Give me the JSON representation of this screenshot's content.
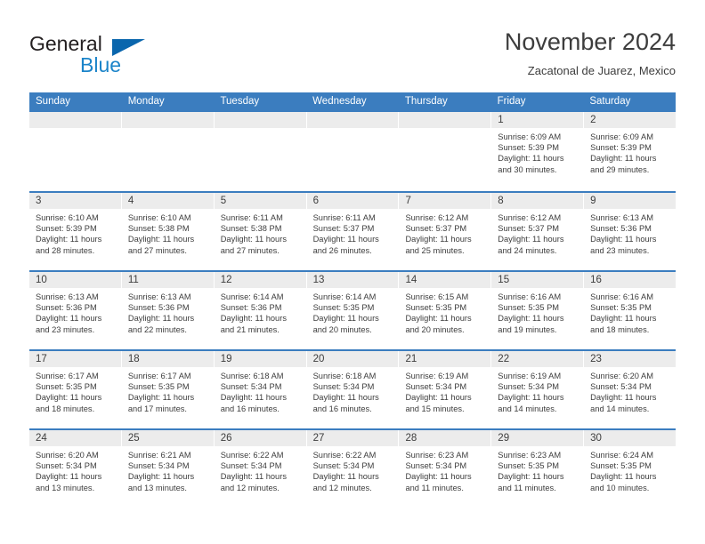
{
  "logo": {
    "word_one": "General",
    "word_two": "Blue",
    "triangle_icon": "blue-triangle-icon",
    "accent_dark": "#0a66ad",
    "accent_light": "#1b84c9"
  },
  "header": {
    "title": "November 2024",
    "subtitle": "Zacatonal de Juarez, Mexico"
  },
  "calendar": {
    "header_color": "#3b7dbf",
    "day_band_color": "#ececec",
    "weekdays": [
      "Sunday",
      "Monday",
      "Tuesday",
      "Wednesday",
      "Thursday",
      "Friday",
      "Saturday"
    ],
    "weeks": [
      [
        {
          "day": "",
          "sunrise": "",
          "sunset": "",
          "daylight": ""
        },
        {
          "day": "",
          "sunrise": "",
          "sunset": "",
          "daylight": ""
        },
        {
          "day": "",
          "sunrise": "",
          "sunset": "",
          "daylight": ""
        },
        {
          "day": "",
          "sunrise": "",
          "sunset": "",
          "daylight": ""
        },
        {
          "day": "",
          "sunrise": "",
          "sunset": "",
          "daylight": ""
        },
        {
          "day": "1",
          "sunrise": "Sunrise: 6:09 AM",
          "sunset": "Sunset: 5:39 PM",
          "daylight": "Daylight: 11 hours and 30 minutes."
        },
        {
          "day": "2",
          "sunrise": "Sunrise: 6:09 AM",
          "sunset": "Sunset: 5:39 PM",
          "daylight": "Daylight: 11 hours and 29 minutes."
        }
      ],
      [
        {
          "day": "3",
          "sunrise": "Sunrise: 6:10 AM",
          "sunset": "Sunset: 5:39 PM",
          "daylight": "Daylight: 11 hours and 28 minutes."
        },
        {
          "day": "4",
          "sunrise": "Sunrise: 6:10 AM",
          "sunset": "Sunset: 5:38 PM",
          "daylight": "Daylight: 11 hours and 27 minutes."
        },
        {
          "day": "5",
          "sunrise": "Sunrise: 6:11 AM",
          "sunset": "Sunset: 5:38 PM",
          "daylight": "Daylight: 11 hours and 27 minutes."
        },
        {
          "day": "6",
          "sunrise": "Sunrise: 6:11 AM",
          "sunset": "Sunset: 5:37 PM",
          "daylight": "Daylight: 11 hours and 26 minutes."
        },
        {
          "day": "7",
          "sunrise": "Sunrise: 6:12 AM",
          "sunset": "Sunset: 5:37 PM",
          "daylight": "Daylight: 11 hours and 25 minutes."
        },
        {
          "day": "8",
          "sunrise": "Sunrise: 6:12 AM",
          "sunset": "Sunset: 5:37 PM",
          "daylight": "Daylight: 11 hours and 24 minutes."
        },
        {
          "day": "9",
          "sunrise": "Sunrise: 6:13 AM",
          "sunset": "Sunset: 5:36 PM",
          "daylight": "Daylight: 11 hours and 23 minutes."
        }
      ],
      [
        {
          "day": "10",
          "sunrise": "Sunrise: 6:13 AM",
          "sunset": "Sunset: 5:36 PM",
          "daylight": "Daylight: 11 hours and 23 minutes."
        },
        {
          "day": "11",
          "sunrise": "Sunrise: 6:13 AM",
          "sunset": "Sunset: 5:36 PM",
          "daylight": "Daylight: 11 hours and 22 minutes."
        },
        {
          "day": "12",
          "sunrise": "Sunrise: 6:14 AM",
          "sunset": "Sunset: 5:36 PM",
          "daylight": "Daylight: 11 hours and 21 minutes."
        },
        {
          "day": "13",
          "sunrise": "Sunrise: 6:14 AM",
          "sunset": "Sunset: 5:35 PM",
          "daylight": "Daylight: 11 hours and 20 minutes."
        },
        {
          "day": "14",
          "sunrise": "Sunrise: 6:15 AM",
          "sunset": "Sunset: 5:35 PM",
          "daylight": "Daylight: 11 hours and 20 minutes."
        },
        {
          "day": "15",
          "sunrise": "Sunrise: 6:16 AM",
          "sunset": "Sunset: 5:35 PM",
          "daylight": "Daylight: 11 hours and 19 minutes."
        },
        {
          "day": "16",
          "sunrise": "Sunrise: 6:16 AM",
          "sunset": "Sunset: 5:35 PM",
          "daylight": "Daylight: 11 hours and 18 minutes."
        }
      ],
      [
        {
          "day": "17",
          "sunrise": "Sunrise: 6:17 AM",
          "sunset": "Sunset: 5:35 PM",
          "daylight": "Daylight: 11 hours and 18 minutes."
        },
        {
          "day": "18",
          "sunrise": "Sunrise: 6:17 AM",
          "sunset": "Sunset: 5:35 PM",
          "daylight": "Daylight: 11 hours and 17 minutes."
        },
        {
          "day": "19",
          "sunrise": "Sunrise: 6:18 AM",
          "sunset": "Sunset: 5:34 PM",
          "daylight": "Daylight: 11 hours and 16 minutes."
        },
        {
          "day": "20",
          "sunrise": "Sunrise: 6:18 AM",
          "sunset": "Sunset: 5:34 PM",
          "daylight": "Daylight: 11 hours and 16 minutes."
        },
        {
          "day": "21",
          "sunrise": "Sunrise: 6:19 AM",
          "sunset": "Sunset: 5:34 PM",
          "daylight": "Daylight: 11 hours and 15 minutes."
        },
        {
          "day": "22",
          "sunrise": "Sunrise: 6:19 AM",
          "sunset": "Sunset: 5:34 PM",
          "daylight": "Daylight: 11 hours and 14 minutes."
        },
        {
          "day": "23",
          "sunrise": "Sunrise: 6:20 AM",
          "sunset": "Sunset: 5:34 PM",
          "daylight": "Daylight: 11 hours and 14 minutes."
        }
      ],
      [
        {
          "day": "24",
          "sunrise": "Sunrise: 6:20 AM",
          "sunset": "Sunset: 5:34 PM",
          "daylight": "Daylight: 11 hours and 13 minutes."
        },
        {
          "day": "25",
          "sunrise": "Sunrise: 6:21 AM",
          "sunset": "Sunset: 5:34 PM",
          "daylight": "Daylight: 11 hours and 13 minutes."
        },
        {
          "day": "26",
          "sunrise": "Sunrise: 6:22 AM",
          "sunset": "Sunset: 5:34 PM",
          "daylight": "Daylight: 11 hours and 12 minutes."
        },
        {
          "day": "27",
          "sunrise": "Sunrise: 6:22 AM",
          "sunset": "Sunset: 5:34 PM",
          "daylight": "Daylight: 11 hours and 12 minutes."
        },
        {
          "day": "28",
          "sunrise": "Sunrise: 6:23 AM",
          "sunset": "Sunset: 5:34 PM",
          "daylight": "Daylight: 11 hours and 11 minutes."
        },
        {
          "day": "29",
          "sunrise": "Sunrise: 6:23 AM",
          "sunset": "Sunset: 5:35 PM",
          "daylight": "Daylight: 11 hours and 11 minutes."
        },
        {
          "day": "30",
          "sunrise": "Sunrise: 6:24 AM",
          "sunset": "Sunset: 5:35 PM",
          "daylight": "Daylight: 11 hours and 10 minutes."
        }
      ]
    ]
  }
}
